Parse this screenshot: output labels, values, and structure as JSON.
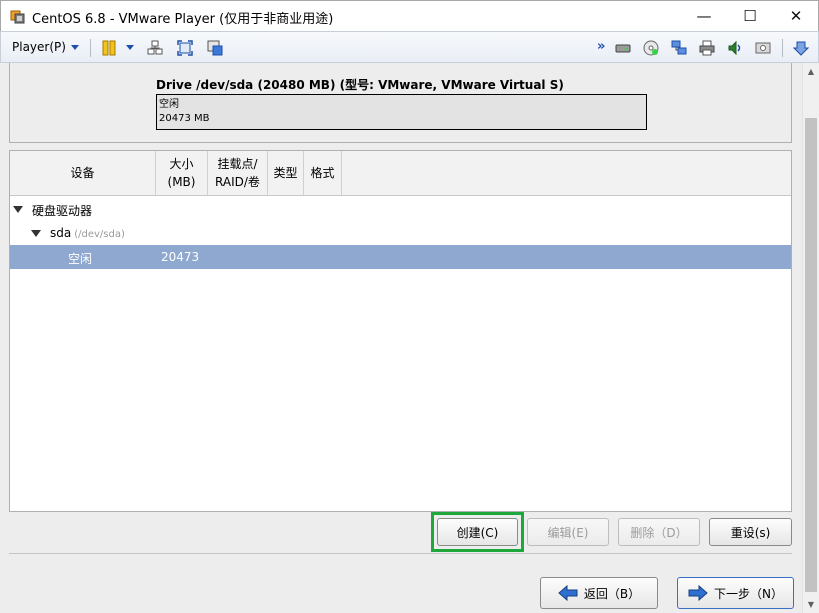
{
  "window": {
    "title": "CentOS 6.8 - VMware Player (仅用于非商业用途)",
    "minimize": "—",
    "maximize": "☐",
    "close": "✕"
  },
  "toolbar": {
    "player_label": "Player(P)",
    "left_icons": [
      "pause-icon",
      "send-ctrl-alt-del-icon",
      "fullscreen-icon",
      "unity-icon"
    ],
    "right_icons": [
      "more-chevron-icon",
      "hard-disk-icon",
      "cd-dvd-icon",
      "network-adapter-icon",
      "printer-icon",
      "sound-card-icon",
      "display-icon",
      "collapse-arrow-icon"
    ]
  },
  "drive": {
    "title": "Drive /dev/sda (20480 MB) (型号: VMware, VMware Virtual S)",
    "bar_label_1": "空闲",
    "bar_label_2": "20473 MB"
  },
  "table": {
    "headers": {
      "device": "设备",
      "size": "大小\n(MB)",
      "mount": "挂载点/\nRAID/卷",
      "type": "类型",
      "format": "格式"
    },
    "rows": [
      {
        "device": "硬盘驱动器",
        "size": ""
      },
      {
        "device": "sda",
        "hint": "(/dev/sda)",
        "size": ""
      },
      {
        "device": "空闲",
        "size": "20473"
      }
    ]
  },
  "actions": {
    "create": "创建(C)",
    "edit": "编辑(E)",
    "delete": "删除（D）",
    "reset": "重设(s)"
  },
  "nav": {
    "back": "返回（B）",
    "next": "下一步（N）"
  },
  "colors": {
    "selection": "#8fa8d0",
    "highlight_green": "#1ea83c",
    "nav_arrow_blue": "#2f6fd0"
  }
}
